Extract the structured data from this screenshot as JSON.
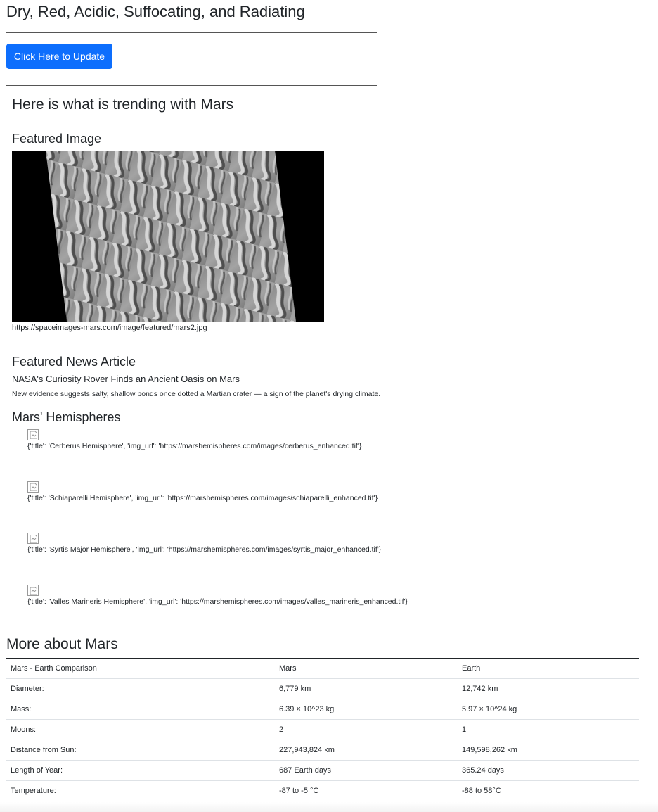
{
  "header": {
    "title": "Dry, Red, Acidic, Suffocating, and Radiating",
    "update_button": "Click Here to Update"
  },
  "trending": {
    "title": "Here is what is trending with Mars",
    "featured_image": {
      "heading": "Featured Image",
      "url": "https://spaceimages-mars.com/image/featured/mars2.jpg"
    },
    "news": {
      "heading": "Featured News Article",
      "title": "NASA's Curiosity Rover Finds an Ancient Oasis on Mars",
      "body": "New evidence suggests salty, shallow ponds once dotted a Martian crater — a sign of the planet's drying climate."
    },
    "hemispheres": {
      "heading": "Mars' Hemispheres",
      "items": [
        {
          "text": "{'title': 'Cerberus Hemisphere', 'img_url': 'https://marshemispheres.com/images/cerberus_enhanced.tif'}",
          "icon": "broken-image-icon"
        },
        {
          "text": "{'title': 'Schiaparelli Hemisphere', 'img_url': 'https://marshemispheres.com/images/schiaparelli_enhanced.tif'}",
          "icon": "broken-image-icon"
        },
        {
          "text": "{'title': 'Syrtis Major Hemisphere', 'img_url': 'https://marshemispheres.com/images/syrtis_major_enhanced.tif'}",
          "icon": "broken-image-icon"
        },
        {
          "text": "{'title': 'Valles Marineris Hemisphere', 'img_url': 'https://marshemispheres.com/images/valles_marineris_enhanced.tif'}",
          "icon": "broken-image-icon"
        }
      ]
    }
  },
  "facts": {
    "title": "More about Mars",
    "rows": [
      [
        "Mars - Earth Comparison",
        "Mars",
        "Earth"
      ],
      [
        "Diameter:",
        "6,779 km",
        "12,742 km"
      ],
      [
        "Mass:",
        "6.39 × 10^23 kg",
        "5.97 × 10^24 kg"
      ],
      [
        "Moons:",
        "2",
        "1"
      ],
      [
        "Distance from Sun:",
        "227,943,824 km",
        "149,598,262 km"
      ],
      [
        "Length of Year:",
        "687 Earth days",
        "365.24 days"
      ],
      [
        "Temperature:",
        "-87 to -5 °C",
        "-88 to 58°C"
      ]
    ]
  },
  "colors": {
    "button_bg": "#0d6efd",
    "button_text": "#ffffff",
    "text": "#212529",
    "image_background": "#000000"
  }
}
